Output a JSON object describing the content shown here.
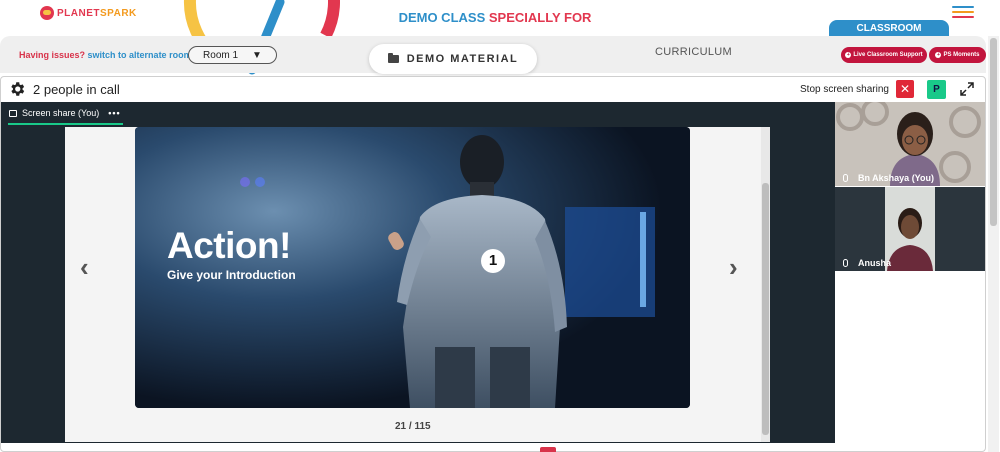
{
  "header": {
    "logo_planet": "PLANET",
    "logo_spark": "SPARK",
    "title_blue": "DEMO CLASS",
    "title_red": "SPECIALLY FOR"
  },
  "toolbar": {
    "issues_text": "Having issues?",
    "switch_link": "switch to alternate room",
    "room_value": "Room 1",
    "demo_material": "DEMO MATERIAL",
    "curriculum": "CURRICULUM",
    "classroom_tab": "CLASSROOM",
    "live_support": "Live Classroom Support",
    "ps_moments": "PS Moments"
  },
  "call": {
    "people_count": "2 people in call",
    "stop_sharing": "Stop screen sharing",
    "p_badge": "P"
  },
  "screen_share": {
    "tab_label": "Screen share (You)",
    "tab_more": "•••",
    "slide_title": "Action!",
    "slide_subtitle": "Give your Introduction",
    "slide_number": "1",
    "page_counter": "21 / 115"
  },
  "participants": [
    {
      "name": "Bn Akshaya (You)"
    },
    {
      "name": "Anusha"
    }
  ],
  "colors": {
    "brand_red": "#e2374f",
    "brand_blue": "#2e8fc9",
    "accent_green": "#19c989",
    "stage_dark": "#1d2830",
    "pill_red": "#c2153d"
  }
}
